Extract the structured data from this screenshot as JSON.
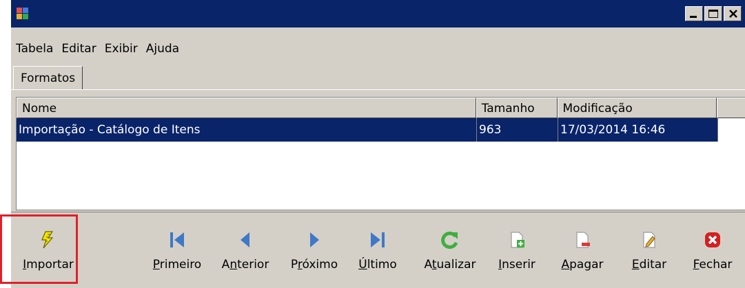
{
  "menu": [
    {
      "label": "Tabela"
    },
    {
      "label": "Editar"
    },
    {
      "label": "Exibir"
    },
    {
      "label": "Ajuda"
    }
  ],
  "tabs": [
    {
      "label": "Formatos",
      "active": true
    }
  ],
  "grid": {
    "columns": [
      "Nome",
      "Tamanho",
      "Modificação"
    ],
    "rows": [
      {
        "nome": "Importação - Catálogo de Itens",
        "tamanho": "963",
        "modificacao": "17/03/2014 16:46",
        "selected": true
      }
    ]
  },
  "toolbar": [
    {
      "icon": "lightning-icon",
      "pre": "",
      "key": "I",
      "post": "mportar",
      "color": "#e6d800"
    },
    {
      "icon": "first-icon",
      "pre": "",
      "key": "P",
      "post": "rimeiro",
      "color": "#3f78c8"
    },
    {
      "icon": "prev-icon",
      "pre": "A",
      "key": "n",
      "post": "terior",
      "color": "#3f78c8"
    },
    {
      "icon": "next-icon",
      "pre": "P",
      "key": "r",
      "post": "óximo",
      "color": "#3f78c8"
    },
    {
      "icon": "last-icon",
      "pre": "",
      "key": "Ú",
      "post": "ltimo",
      "color": "#3f78c8"
    },
    {
      "icon": "refresh-icon",
      "pre": "A",
      "key": "t",
      "post": "ualizar",
      "color": "#3fae3f"
    },
    {
      "icon": "insert-icon",
      "pre": "",
      "key": "I",
      "post": "nserir",
      "color": "#3fae3f"
    },
    {
      "icon": "delete-icon",
      "pre": "",
      "key": "A",
      "post": "pagar",
      "color": "#d83a3a"
    },
    {
      "icon": "edit-icon",
      "pre": "",
      "key": "E",
      "post": "ditar",
      "color": "#e5b23a"
    },
    {
      "icon": "close-icon",
      "pre": "",
      "key": "F",
      "post": "echar",
      "color": "#d42020"
    }
  ],
  "colors": {
    "titlebar": "#0a246a",
    "selection": "#0a246a",
    "highlight": "#e0202a"
  }
}
